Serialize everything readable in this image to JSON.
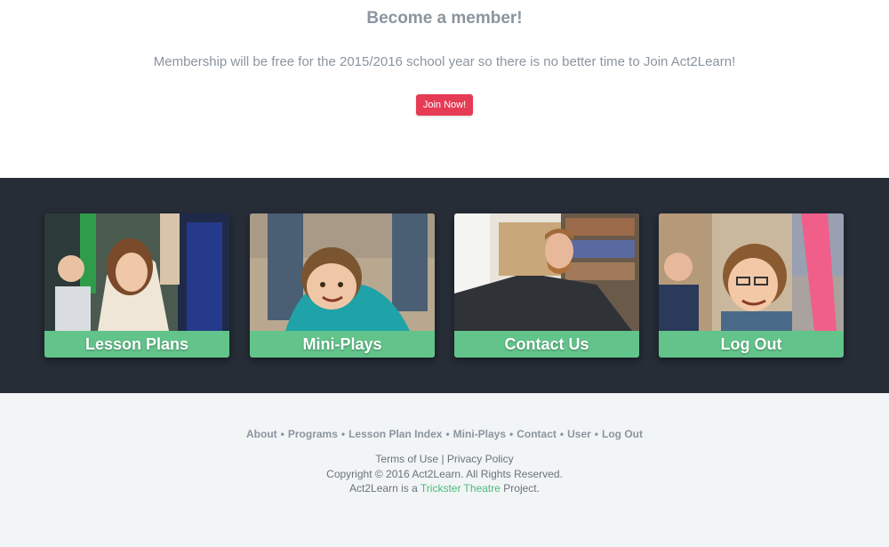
{
  "member": {
    "title": "Become a member!",
    "text": "Membership will be free for the 2015/2016 school year so there is no better time to Join Act2Learn!",
    "join_label": "Join Now!"
  },
  "tiles": [
    {
      "label": "Lesson Plans"
    },
    {
      "label": "Mini-Plays"
    },
    {
      "label": "Contact Us"
    },
    {
      "label": "Log Out"
    }
  ],
  "footer": {
    "nav": [
      "About",
      "Programs",
      "Lesson Plan Index",
      "Mini-Plays",
      "Contact",
      "User",
      "Log Out"
    ],
    "separator": "•",
    "terms": "Terms of Use",
    "pipe": "|",
    "privacy": "Privacy Policy",
    "copyright": "Copyright © 2016 Act2Learn. All Rights Reserved.",
    "project_prefix": "Act2Learn is a",
    "project_link": "Trickster Theatre",
    "project_suffix": "Project."
  },
  "colors": {
    "accent_red": "#e63b55",
    "tile_green": "#62c48a",
    "dark_band": "#262d37",
    "link_green": "#4cb87a"
  }
}
